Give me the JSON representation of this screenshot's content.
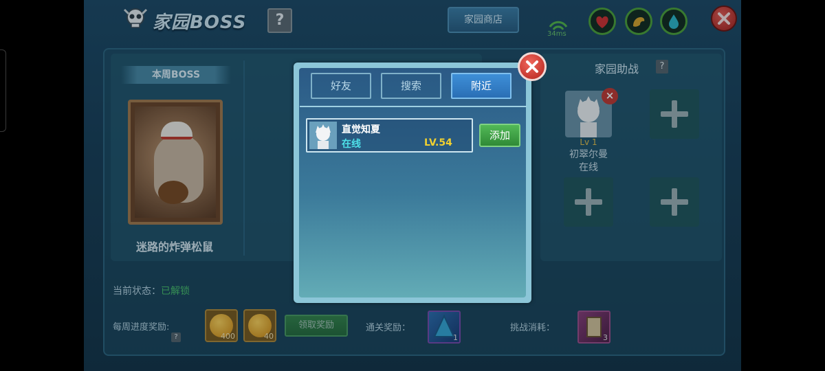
{
  "header": {
    "title": "家园BOSS",
    "help_label": "?",
    "shop_label": "家园商店",
    "ping": "34ms"
  },
  "boss": {
    "ribbon_label": "本周BOSS",
    "name": "迷路的炸弹松鼠"
  },
  "status": {
    "label": "当前状态：",
    "value": "已解锁"
  },
  "rewards": {
    "weekly_label": "每周进度奖励:",
    "weekly_help": "?",
    "items": [
      {
        "icon": "gold-coin-icon",
        "qty": "400"
      },
      {
        "icon": "gold-coin-icon",
        "qty": "40"
      }
    ],
    "claim_label": "领取奖励",
    "clear_label": "通关奖励：",
    "clear_item": {
      "icon": "crystal-item-icon",
      "qty": "1"
    },
    "cost_label": "挑战消耗：",
    "cost_item": {
      "icon": "scroll-item-icon",
      "qty": "3"
    }
  },
  "assist": {
    "title": "家园助战",
    "help_label": "?",
    "friend": {
      "level": "Lv 1",
      "name": "初翠尔曼",
      "status": "在线",
      "remove_label": "×"
    }
  },
  "modal": {
    "tabs": [
      {
        "label": "好友",
        "active": false
      },
      {
        "label": "搜索",
        "active": false
      },
      {
        "label": "附近",
        "active": true
      }
    ],
    "results": [
      {
        "name": "直觉知夏",
        "status": "在线",
        "level": "LV.54",
        "add_label": "添加"
      }
    ]
  },
  "colors": {
    "accent_green": "#4bc06b",
    "online_cyan": "#4ee0e8",
    "level_gold": "#f0d030",
    "close_red": "#c23a33"
  }
}
